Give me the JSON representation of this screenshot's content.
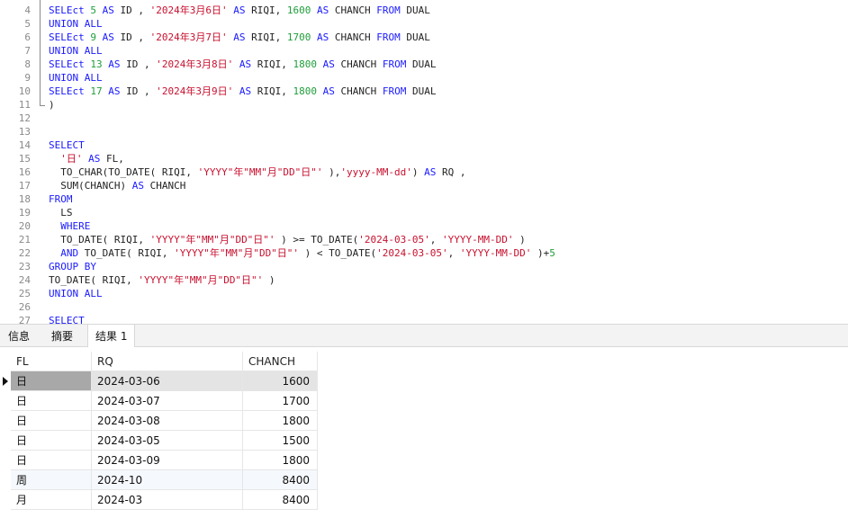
{
  "editor": {
    "lines": [
      {
        "n": "4",
        "tokens": [
          [
            "kw",
            "SELEct "
          ],
          [
            "num",
            "5"
          ],
          [
            "kw",
            " AS "
          ],
          [
            "plain",
            "ID , "
          ],
          [
            "str",
            "'2024年3月6日'"
          ],
          [
            "kw",
            " AS "
          ],
          [
            "plain",
            "RIQI, "
          ],
          [
            "num",
            "1600"
          ],
          [
            "kw",
            " AS "
          ],
          [
            "plain",
            "CHANCH "
          ],
          [
            "kw",
            "FROM "
          ],
          [
            "plain",
            "DUAL"
          ]
        ]
      },
      {
        "n": "5",
        "tokens": [
          [
            "kw",
            "UNION ALL"
          ]
        ]
      },
      {
        "n": "6",
        "tokens": [
          [
            "kw",
            "SELEct "
          ],
          [
            "num",
            "9"
          ],
          [
            "kw",
            " AS "
          ],
          [
            "plain",
            "ID , "
          ],
          [
            "str",
            "'2024年3月7日'"
          ],
          [
            "kw",
            " AS "
          ],
          [
            "plain",
            "RIQI, "
          ],
          [
            "num",
            "1700"
          ],
          [
            "kw",
            " AS "
          ],
          [
            "plain",
            "CHANCH "
          ],
          [
            "kw",
            "FROM "
          ],
          [
            "plain",
            "DUAL"
          ]
        ]
      },
      {
        "n": "7",
        "tokens": [
          [
            "kw",
            "UNION ALL"
          ]
        ]
      },
      {
        "n": "8",
        "tokens": [
          [
            "kw",
            "SELEct "
          ],
          [
            "num",
            "13"
          ],
          [
            "kw",
            " AS "
          ],
          [
            "plain",
            "ID , "
          ],
          [
            "str",
            "'2024年3月8日'"
          ],
          [
            "kw",
            " AS "
          ],
          [
            "plain",
            "RIQI, "
          ],
          [
            "num",
            "1800"
          ],
          [
            "kw",
            " AS "
          ],
          [
            "plain",
            "CHANCH "
          ],
          [
            "kw",
            "FROM "
          ],
          [
            "plain",
            "DUAL"
          ]
        ]
      },
      {
        "n": "9",
        "tokens": [
          [
            "kw",
            "UNION ALL"
          ]
        ]
      },
      {
        "n": "10",
        "tokens": [
          [
            "kw",
            "SELEct "
          ],
          [
            "num",
            "17"
          ],
          [
            "kw",
            " AS "
          ],
          [
            "plain",
            "ID , "
          ],
          [
            "str",
            "'2024年3月9日'"
          ],
          [
            "kw",
            " AS "
          ],
          [
            "plain",
            "RIQI, "
          ],
          [
            "num",
            "1800"
          ],
          [
            "kw",
            " AS "
          ],
          [
            "plain",
            "CHANCH "
          ],
          [
            "kw",
            "FROM "
          ],
          [
            "plain",
            "DUAL"
          ]
        ]
      },
      {
        "n": "11",
        "tokens": [
          [
            "plain",
            ")"
          ]
        ]
      },
      {
        "n": "12",
        "tokens": []
      },
      {
        "n": "13",
        "tokens": []
      },
      {
        "n": "14",
        "tokens": [
          [
            "kw",
            "SELECT"
          ]
        ]
      },
      {
        "n": "15",
        "tokens": [
          [
            "str",
            "  '日'"
          ],
          [
            "kw",
            " AS "
          ],
          [
            "plain",
            "FL,"
          ]
        ]
      },
      {
        "n": "16",
        "tokens": [
          [
            "plain",
            "  TO_CHAR(TO_DATE( RIQI, "
          ],
          [
            "str",
            "'YYYY\"年\"MM\"月\"DD\"日\"'"
          ],
          [
            "plain",
            " ),"
          ],
          [
            "str",
            "'yyyy-MM-dd'"
          ],
          [
            "plain",
            ") "
          ],
          [
            "kw",
            "AS "
          ],
          [
            "plain",
            "RQ ,"
          ]
        ]
      },
      {
        "n": "17",
        "tokens": [
          [
            "plain",
            "  SUM(CHANCH) "
          ],
          [
            "kw",
            "AS "
          ],
          [
            "plain",
            "CHANCH"
          ]
        ]
      },
      {
        "n": "18",
        "tokens": [
          [
            "kw",
            "FROM"
          ]
        ]
      },
      {
        "n": "19",
        "tokens": [
          [
            "plain",
            "  LS"
          ]
        ]
      },
      {
        "n": "20",
        "tokens": [
          [
            "kw",
            "  WHERE"
          ]
        ]
      },
      {
        "n": "21",
        "tokens": [
          [
            "plain",
            "  TO_DATE( RIQI, "
          ],
          [
            "str",
            "'YYYY\"年\"MM\"月\"DD\"日\"'"
          ],
          [
            "plain",
            " ) >= TO_DATE("
          ],
          [
            "str",
            "'2024-03-05'"
          ],
          [
            "plain",
            ", "
          ],
          [
            "str",
            "'YYYY-MM-DD'"
          ],
          [
            "plain",
            " )"
          ]
        ]
      },
      {
        "n": "22",
        "tokens": [
          [
            "kw",
            "  AND "
          ],
          [
            "plain",
            "TO_DATE( RIQI, "
          ],
          [
            "str",
            "'YYYY\"年\"MM\"月\"DD\"日\"'"
          ],
          [
            "plain",
            " ) < TO_DATE("
          ],
          [
            "str",
            "'2024-03-05'"
          ],
          [
            "plain",
            ", "
          ],
          [
            "str",
            "'YYYY-MM-DD'"
          ],
          [
            "plain",
            " )+"
          ],
          [
            "num",
            "5"
          ]
        ]
      },
      {
        "n": "23",
        "tokens": [
          [
            "kw",
            "GROUP BY"
          ]
        ]
      },
      {
        "n": "24",
        "tokens": [
          [
            "plain",
            "TO_DATE( RIQI, "
          ],
          [
            "str",
            "'YYYY\"年\"MM\"月\"DD\"日\"'"
          ],
          [
            "plain",
            " )"
          ]
        ]
      },
      {
        "n": "25",
        "tokens": [
          [
            "kw",
            "UNION ALL"
          ]
        ]
      },
      {
        "n": "26",
        "tokens": []
      },
      {
        "n": "27",
        "tokens": [
          [
            "kw",
            "SELECT"
          ]
        ]
      }
    ]
  },
  "tabs": [
    {
      "label": "信息",
      "active": false
    },
    {
      "label": "摘要",
      "active": false
    },
    {
      "label": "结果 1",
      "active": true
    }
  ],
  "grid": {
    "columns": [
      "FL",
      "RQ",
      "CHANCH"
    ],
    "rows": [
      [
        "日",
        "2024-03-06",
        "1600"
      ],
      [
        "日",
        "2024-03-07",
        "1700"
      ],
      [
        "日",
        "2024-03-08",
        "1800"
      ],
      [
        "日",
        "2024-03-05",
        "1500"
      ],
      [
        "日",
        "2024-03-09",
        "1800"
      ],
      [
        "周",
        "2024-10",
        "8400"
      ],
      [
        "月",
        "2024-03",
        "8400"
      ]
    ],
    "selected_row": 0
  }
}
